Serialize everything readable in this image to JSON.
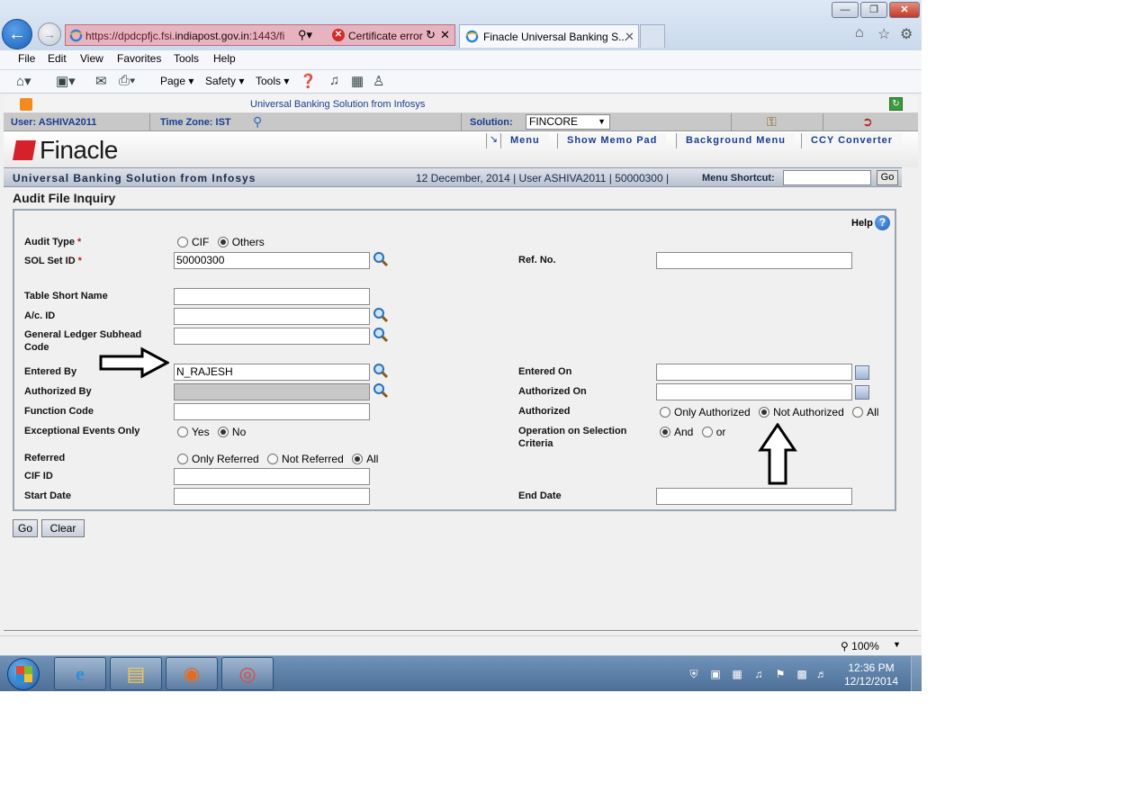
{
  "browser": {
    "url_prefix": "https://dpdcpfjc.fsi.",
    "url_domain": "indiapost.gov.in",
    "url_suffix": ":1443/fi",
    "cert_error": "Certificate error",
    "tab_title": "Finacle Universal Banking S...",
    "menu": [
      "File",
      "Edit",
      "View",
      "Favorites",
      "Tools",
      "Help"
    ],
    "commands": {
      "page": "Page",
      "safety": "Safety",
      "tools": "Tools"
    }
  },
  "finacle": {
    "top_title": "Universal Banking Solution from Infosys",
    "user_label": "User: ASHIVA2011",
    "timezone_label": "Time Zone:  IST",
    "solution_label": "Solution:",
    "solution_value": "FINCORE",
    "logo_text": "Finacle",
    "top_links": [
      "Menu",
      "Show Memo Pad",
      "Background Menu",
      "CCY Converter"
    ],
    "bar_title": "Universal Banking Solution from Infosys",
    "bar_info": "12 December, 2014  |  User  ASHIVA2011  |  50000300  |",
    "shortcut_label": "Menu Shortcut:",
    "shortcut_go": "Go"
  },
  "form": {
    "title": "Audit File Inquiry",
    "help": "Help",
    "audit_type": {
      "label": "Audit Type",
      "options": [
        "CIF",
        "Others"
      ],
      "selected": "Others"
    },
    "sol_set_id": {
      "label": "SOL Set ID",
      "value": "50000300"
    },
    "ref_no": {
      "label": "Ref. No.",
      "value": ""
    },
    "table_short_name": {
      "label": "Table Short Name",
      "value": ""
    },
    "ac_id": {
      "label": "A/c. ID",
      "value": ""
    },
    "gl_subhead": {
      "label": "General Ledger Subhead Code",
      "value": ""
    },
    "entered_by": {
      "label": "Entered By",
      "value": "N_RAJESH"
    },
    "entered_on": {
      "label": "Entered On",
      "value": ""
    },
    "authorized_by": {
      "label": "Authorized By",
      "value": ""
    },
    "authorized_on": {
      "label": "Authorized On",
      "value": ""
    },
    "function_code": {
      "label": "Function Code",
      "value": ""
    },
    "authorized": {
      "label": "Authorized",
      "options": [
        "Only Authorized",
        "Not Authorized",
        "All"
      ],
      "selected": "Not Authorized"
    },
    "exceptional": {
      "label": "Exceptional Events Only",
      "options": [
        "Yes",
        "No"
      ],
      "selected": "No"
    },
    "operation": {
      "label": "Operation on Selection Criteria",
      "options": [
        "And",
        "or"
      ],
      "selected": "And"
    },
    "referred": {
      "label": "Referred",
      "options": [
        "Only Referred",
        "Not Referred",
        "All"
      ],
      "selected": "All"
    },
    "cif_id": {
      "label": "CIF ID",
      "value": ""
    },
    "start_date": {
      "label": "Start Date",
      "value": ""
    },
    "end_date": {
      "label": "End Date",
      "value": ""
    },
    "go": "Go",
    "clear": "Clear"
  },
  "status": {
    "zoom": "100%"
  },
  "taskbar": {
    "time": "12:36 PM",
    "date": "12/12/2014"
  }
}
